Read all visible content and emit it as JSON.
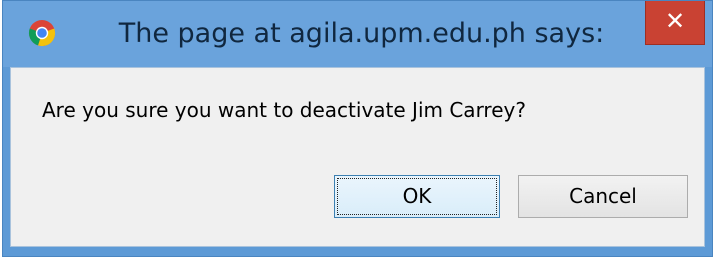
{
  "dialog": {
    "title": "The page at agila.upm.edu.ph says:",
    "app_icon": "chrome-icon",
    "close_icon": "close-icon",
    "close_glyph": "✕",
    "message": "Are you sure you want to deactivate Jim Carrey?",
    "ok_label": "OK",
    "cancel_label": "Cancel"
  },
  "colors": {
    "titlebar": "#6aa3dc",
    "close_button": "#c94233",
    "content_background": "#f0f0f0",
    "default_button_border": "#3c7fb1"
  }
}
